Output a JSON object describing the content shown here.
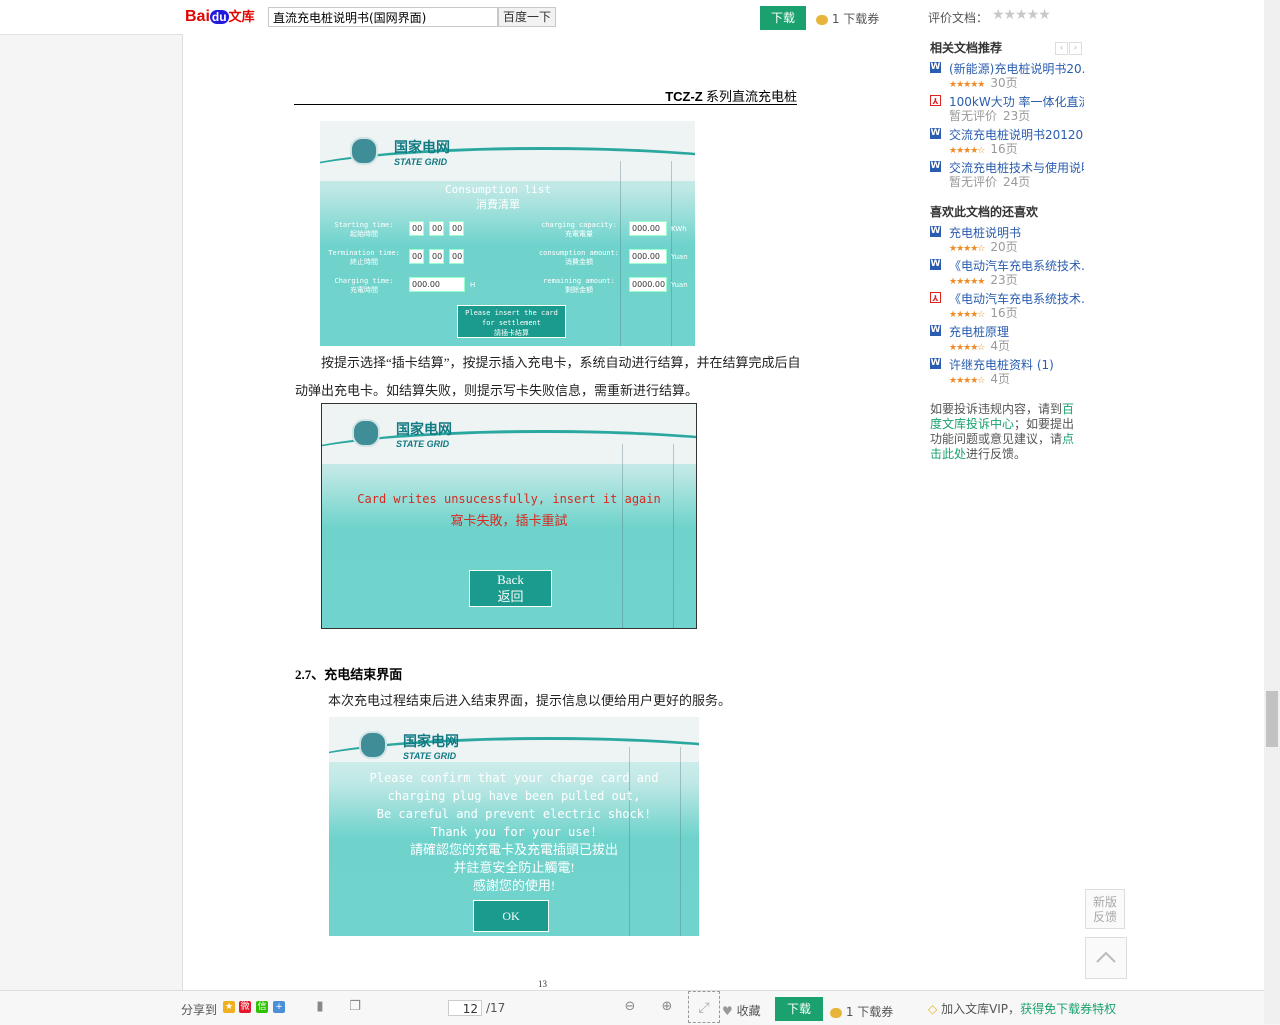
{
  "topbar": {
    "logo_bai": "Bai",
    "logo_du": "du",
    "logo_wenku": "文库",
    "search_value": "直流充电桩说明书(国网界面)",
    "search_button": "百度一下",
    "download_label": "下载",
    "ticket_label": "1 下载券",
    "rating_label": "评价文档：",
    "rating_stars": "★★★★★"
  },
  "document": {
    "header_bold": "TCZ-Z",
    "header_text": " 系列直流充电桩",
    "logo_cn": "国家电网",
    "logo_en": "STATE GRID",
    "screen1": {
      "title_en": "Consumption list",
      "title_cn": "消費清單",
      "start_label_en": "Starting time:",
      "start_label_cn": "起始時間",
      "start_h": "00",
      "start_m": "00",
      "start_s": "00",
      "end_label_en": "Termination time:",
      "end_label_cn": "終止時間",
      "end_h": "00",
      "end_m": "00",
      "end_s": "00",
      "dur_label_en": "Charging time:",
      "dur_label_cn": "充電時間",
      "dur_value": "000.00",
      "dur_unit": "H",
      "cap_label_en": "charging capacity:",
      "cap_label_cn": "充電電量",
      "cap_value": "000.00",
      "cap_unit": "KWh",
      "amt_label_en": "consumption amount:",
      "amt_label_cn": "消費金額",
      "amt_value": "000.00",
      "amt_unit": "Yuan",
      "rem_label_en": "remaining amount:",
      "rem_label_cn": "剩餘金額",
      "rem_value": "0000.00",
      "rem_unit": "Yuan",
      "btn_en1": "Please insert the card",
      "btn_en2": "for settlement",
      "btn_cn": "請插卡結算"
    },
    "para1_line1": "按提示选择“插卡结算”，按提示插入充电卡，系统自动进行结算，并在结算完成后自",
    "para1_line2": "动弹出充电卡。如结算失败，则提示写卡失败信息，需重新进行结算。",
    "screen2": {
      "msg_en": "Card writes unsucessfully, insert it again",
      "msg_cn": "寫卡失敗，插卡重試",
      "btn_en": "Back",
      "btn_cn": "返回"
    },
    "section_title": "2.7、充电结束界面",
    "para2": "本次充电过程结束后进入结束界面，提示信息以便给用户更好的服务。",
    "screen3": {
      "line1": "Please confirm that your charge card and",
      "line2": "charging plug have been pulled out,",
      "line3": "Be careful and prevent electric shock!",
      "line4": "Thank you for your use!",
      "line5": "請確認您的充電卡及充電插頭已拔出",
      "line6": "并註意安全防止觸電!",
      "line7": "感謝您的使用!",
      "btn": "OK"
    },
    "page_number": "13"
  },
  "sidebar": {
    "related_title": "相关文档推荐",
    "related": [
      {
        "type": "word",
        "title": "(新能源)充电桩说明书20...",
        "stars": "★★★★★",
        "pages": "30页"
      },
      {
        "type": "pdf",
        "title": "100kW大功 率一体化直流...",
        "stars": "暂无评价",
        "pages": "23页"
      },
      {
        "type": "word",
        "title": "交流充电桩说明书20120...",
        "stars": "★★★★☆",
        "pages": "16页"
      },
      {
        "type": "word",
        "title": "交流充电桩技术与使用说明...",
        "stars": "暂无评价",
        "pages": "24页"
      }
    ],
    "liked_title": "喜欢此文档的还喜欢",
    "liked": [
      {
        "type": "word",
        "title": "充电桩说明书",
        "stars": "★★★★☆",
        "pages": "20页"
      },
      {
        "type": "word",
        "title": "《电动汽车充电系统技术...",
        "stars": "★★★★★",
        "pages": "23页"
      },
      {
        "type": "pdf",
        "title": "《电动汽车充电系统技术...",
        "stars": "★★★★☆",
        "pages": "16页"
      },
      {
        "type": "word",
        "title": "充电桩原理",
        "stars": "★★★★☆",
        "pages": "4页"
      },
      {
        "type": "word",
        "title": "许继充电桩资料 (1)",
        "stars": "★★★★☆",
        "pages": "4页"
      }
    ],
    "complain_1": "如要投诉违规内容，请到",
    "complain_link1": "百度文库投诉中心",
    "complain_2": "；如要提出功能问题或意见建议，请",
    "complain_link2": "点击此处",
    "complain_3": "进行反馈。"
  },
  "float": {
    "feedback": "新版反馈",
    "top_icon": "chevron-up-icon"
  },
  "bottombar": {
    "share_label": "分享到",
    "page_current": "12",
    "page_total": "/17",
    "fav_label": "收藏",
    "download_label": "下载",
    "ticket_label": "1 下载券",
    "vip_text": "加入文库VIP，",
    "vip_link": "获得免下载券特权"
  }
}
